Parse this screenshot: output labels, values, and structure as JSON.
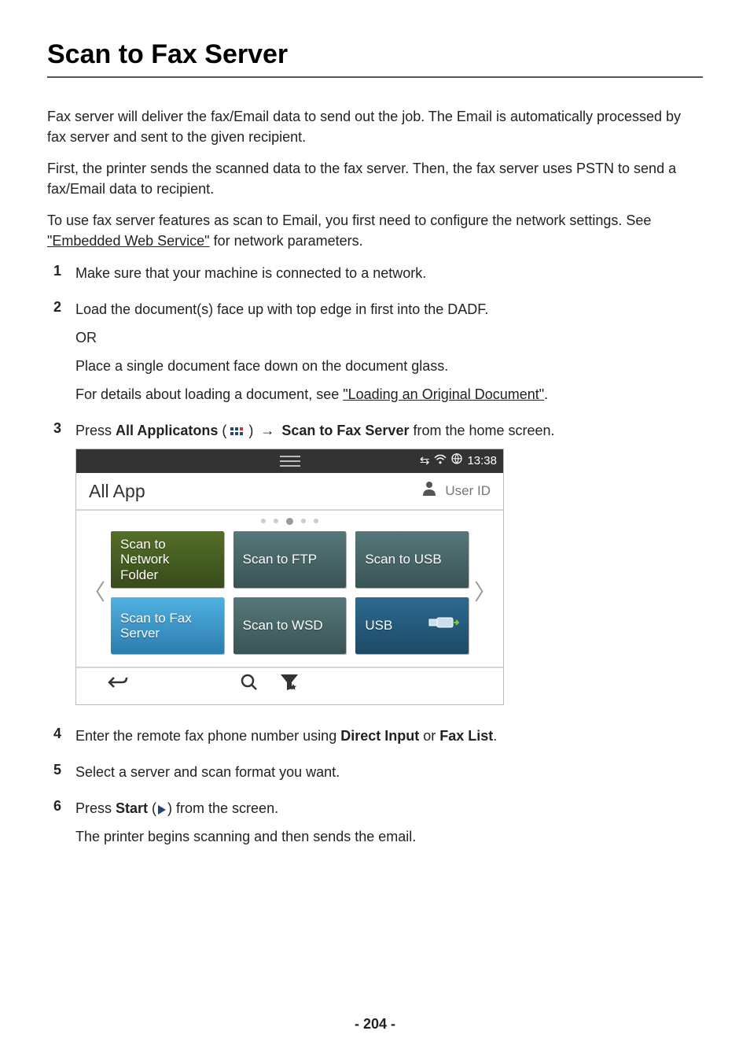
{
  "title": "Scan to Fax Server",
  "intro": [
    "Fax server will deliver the fax/Email data to send out the job. The Email is automatically processed by fax server and sent to the given recipient.",
    "First, the printer sends the scanned data to the fax server. Then, the fax server uses PSTN to send a fax/Email data to recipient."
  ],
  "intro3_pre": "To use fax server features as scan to Email, you first need to configure the network settings. See ",
  "intro3_link": "\"Embedded Web Service\"",
  "intro3_post": " for network parameters.",
  "steps": {
    "s1": "Make sure that your machine is connected to a network.",
    "s2a": "Load the document(s) face up with top edge in first into the DADF.",
    "s2b": "OR",
    "s2c": "Place a single document face down on the document glass.",
    "s2d_pre": "For details about loading a document, see ",
    "s2d_link": "\"Loading an Original Document\"",
    "s2d_post": ".",
    "s3_pre": "Press ",
    "s3_b1": "All Applicatons",
    "s3_mid": " ( ",
    "s3_close": " ) ",
    "s3_b2": "Scan to Fax Server",
    "s3_end": " from the home screen.",
    "s4_pre": "Enter the remote fax phone number using ",
    "s4_b1": "Direct Input",
    "s4_or": " or ",
    "s4_b2": "Fax List",
    "s4_end": ".",
    "s5": "Select a server and scan format you want.",
    "s6_pre": "Press ",
    "s6_b": "Start",
    "s6_paren_open": " (",
    "s6_paren_close": ") ",
    "s6_end": "from the screen.",
    "s6_follow": "The printer begins scanning and then sends the email."
  },
  "screen": {
    "time": "13:38",
    "app_title": "All App",
    "user": "User ID",
    "tiles": {
      "t1": "Scan to\nNetwork\nFolder",
      "t2": "Scan to FTP",
      "t3": "Scan to USB",
      "t4": "Scan to Fax\nServer",
      "t5": "Scan to WSD",
      "t6": "USB"
    }
  },
  "page_number": "- 204 -"
}
